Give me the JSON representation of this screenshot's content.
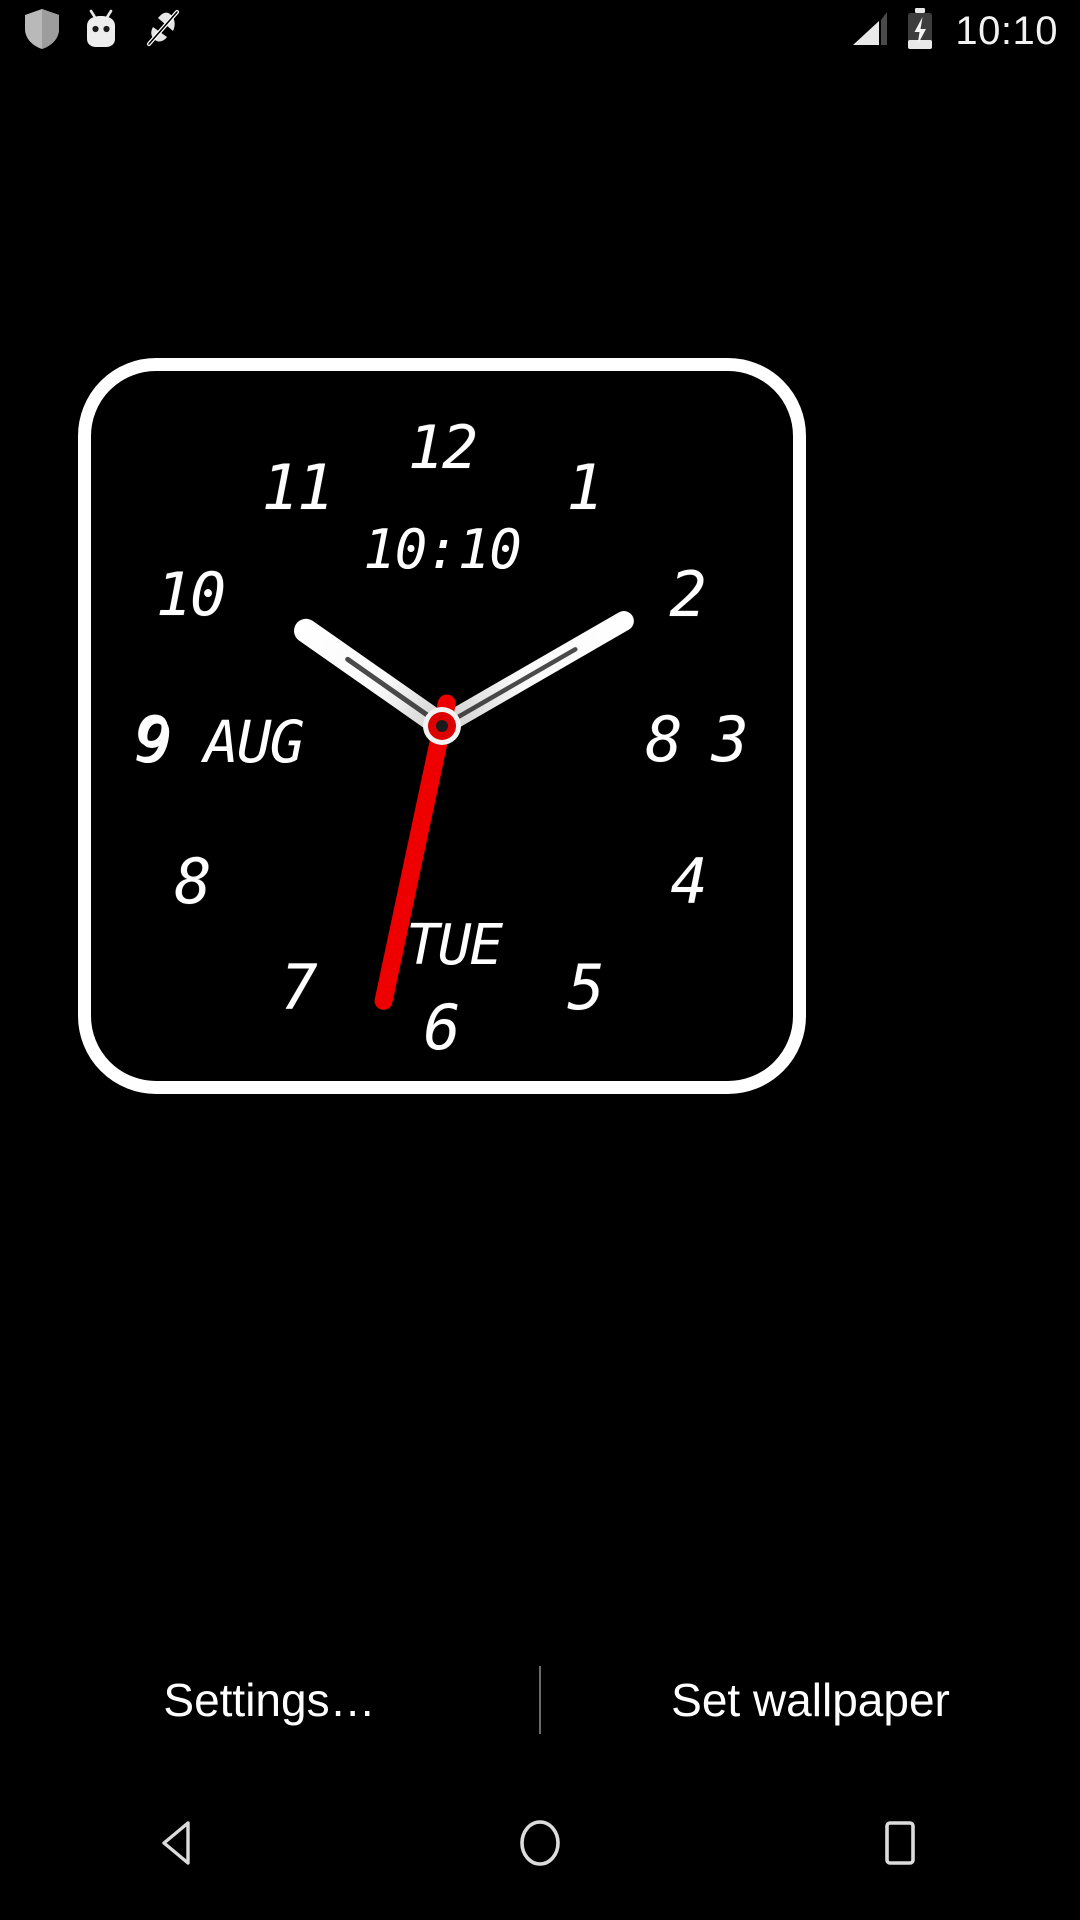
{
  "status_bar": {
    "time": "10:10",
    "left_icons": [
      {
        "name": "shield-icon",
        "label": "shield"
      },
      {
        "name": "android-head-icon",
        "label": "android"
      },
      {
        "name": "notifications-muted-icon",
        "label": "muted"
      }
    ],
    "right_icons": [
      {
        "name": "signal-bars-icon",
        "label": "cellular signal"
      },
      {
        "name": "battery-charging-icon",
        "label": "battery charging"
      }
    ]
  },
  "clock_widget": {
    "digital_time": "10:10",
    "date": "9 AUG",
    "weekday": "TUE",
    "numerals": [
      {
        "value": "12",
        "pos": "12"
      },
      {
        "value": "1",
        "pos": "1"
      },
      {
        "value": "2",
        "pos": "2"
      },
      {
        "value": "3",
        "pos": "3"
      },
      {
        "value": "4",
        "pos": "4"
      },
      {
        "value": "5",
        "pos": "5"
      },
      {
        "value": "6",
        "pos": "6"
      },
      {
        "value": "7",
        "pos": "7"
      },
      {
        "value": "8",
        "pos": "8"
      },
      {
        "value": "9",
        "pos": "9"
      },
      {
        "value": "10",
        "pos": "10"
      },
      {
        "value": "11",
        "pos": "11"
      }
    ],
    "battery_numeral": "8",
    "colors": {
      "frame": "#ffffff",
      "face": "#000000",
      "hands": "#ffffff",
      "second_hand": "#ee0000",
      "hub": "#dd0000"
    },
    "hands": {
      "hour_angle_deg": 305,
      "minute_angle_deg": 60,
      "second_angle_deg": 192
    }
  },
  "wallpaper_actions": {
    "settings_label": "Settings…",
    "set_wallpaper_label": "Set wallpaper"
  },
  "nav_bar": {
    "back_label": "Back",
    "home_label": "Home",
    "recents_label": "Recents"
  }
}
